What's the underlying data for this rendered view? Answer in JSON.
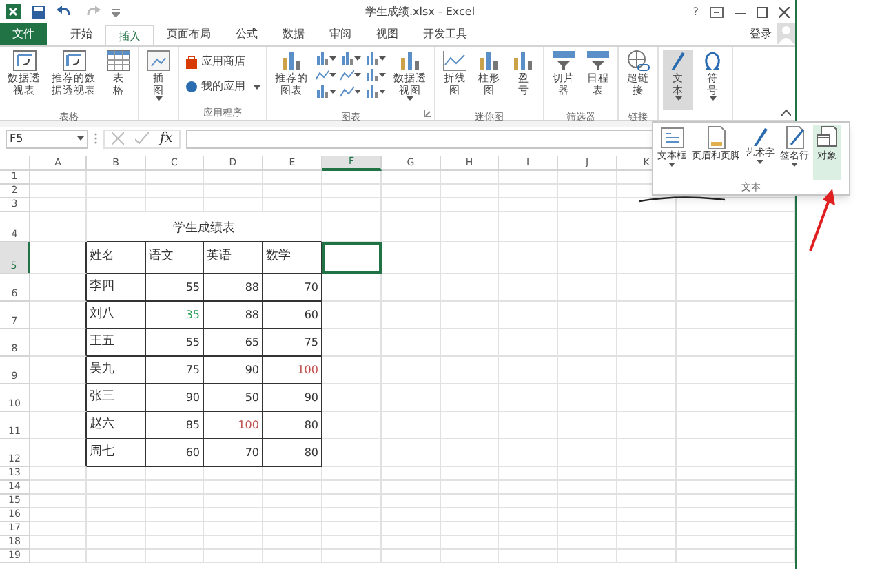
{
  "window": {
    "title": "学生成绩.xlsx - Excel",
    "help": "?"
  },
  "tabs": [
    {
      "label": "文件",
      "kind": "file",
      "selected": false
    },
    {
      "label": "开始",
      "kind": "tab",
      "selected": false
    },
    {
      "label": "插入",
      "kind": "tab",
      "selected": true
    },
    {
      "label": "页面布局",
      "kind": "tab",
      "selected": false
    },
    {
      "label": "公式",
      "kind": "tab",
      "selected": false
    },
    {
      "label": "数据",
      "kind": "tab",
      "selected": false
    },
    {
      "label": "审阅",
      "kind": "tab",
      "selected": false
    },
    {
      "label": "视图",
      "kind": "tab",
      "selected": false
    },
    {
      "label": "开发工具",
      "kind": "tab",
      "selected": false
    }
  ],
  "account": {
    "label": "登录"
  },
  "ribbon": {
    "groups": [
      {
        "label": "表格",
        "buttons": [
          {
            "kind": "large",
            "label": "数据透视表",
            "dropdown": false,
            "pressed": false
          },
          {
            "kind": "large",
            "label": "推荐的数据透视表",
            "dropdown": false,
            "pressed": false
          },
          {
            "kind": "large",
            "label": "表格",
            "dropdown": false,
            "pressed": false
          }
        ]
      },
      {
        "buttons": [
          {
            "kind": "large",
            "label": "插图",
            "dropdown": true,
            "pressed": false
          }
        ]
      },
      {
        "label": "应用程序",
        "buttons": [
          {
            "kind": "small",
            "label": "应用商店",
            "dropdown": false,
            "pressed": false
          },
          {
            "kind": "small",
            "label": "我的应用",
            "dropdown": true,
            "pressed": false
          }
        ]
      },
      {
        "label": "图表",
        "launcher": true,
        "buttons": [
          {
            "kind": "large",
            "label": "推荐的图表",
            "dropdown": false,
            "pressed": false
          },
          {
            "kind": "icons",
            "dropdown": true,
            "pressed": false
          },
          {
            "kind": "large",
            "label": "数据透视图",
            "dropdown": true,
            "pressed": false
          }
        ]
      },
      {
        "label": "迷你图",
        "buttons": [
          {
            "kind": "large",
            "label": "折线图",
            "dropdown": false,
            "pressed": false
          },
          {
            "kind": "large",
            "label": "柱形图",
            "dropdown": false,
            "pressed": false
          },
          {
            "kind": "large",
            "label": "盈亏",
            "dropdown": false,
            "pressed": false
          }
        ]
      },
      {
        "label": "筛选器",
        "buttons": [
          {
            "kind": "large",
            "label": "切片器",
            "dropdown": false,
            "pressed": false
          },
          {
            "kind": "large",
            "label": "日程表",
            "dropdown": false,
            "pressed": false
          }
        ]
      },
      {
        "label": "链接",
        "buttons": [
          {
            "kind": "large",
            "label": "超链接",
            "dropdown": false,
            "pressed": false
          }
        ]
      },
      {
        "buttons": [
          {
            "kind": "large",
            "label": "文本",
            "dropdown": true,
            "pressed": true
          },
          {
            "kind": "large",
            "label": "符号",
            "dropdown": true,
            "pressed": false
          }
        ]
      }
    ]
  },
  "text_menu": {
    "label": "文本",
    "items": [
      {
        "label": "文本框",
        "dropdown": true,
        "selected": false
      },
      {
        "label": "页眉和页脚",
        "dropdown": false,
        "selected": false
      },
      {
        "label": "艺术字",
        "dropdown": true,
        "selected": false
      },
      {
        "label": "签名行",
        "dropdown": true,
        "selected": false
      },
      {
        "label": "对象",
        "dropdown": false,
        "selected": true
      }
    ]
  },
  "formula_bar": {
    "name_box": "F5",
    "function_label": "fx"
  },
  "sheet": {
    "columns": [
      {
        "label": "A",
        "selected": false
      },
      {
        "label": "B",
        "selected": false
      },
      {
        "label": "C",
        "selected": false
      },
      {
        "label": "D",
        "selected": false
      },
      {
        "label": "E",
        "selected": false
      },
      {
        "label": "F",
        "selected": true
      },
      {
        "label": "G",
        "selected": false
      },
      {
        "label": "H",
        "selected": false
      },
      {
        "label": "I",
        "selected": false
      },
      {
        "label": "J",
        "selected": false
      },
      {
        "label": "K",
        "selected": false
      }
    ],
    "rows": [
      {
        "label": "1",
        "selected": false
      },
      {
        "label": "2",
        "selected": false
      },
      {
        "label": "3",
        "selected": false
      },
      {
        "label": "4",
        "selected": false
      },
      {
        "label": "5",
        "selected": true
      },
      {
        "label": "6",
        "selected": false
      },
      {
        "label": "7",
        "selected": false
      },
      {
        "label": "8",
        "selected": false
      },
      {
        "label": "9",
        "selected": false
      },
      {
        "label": "10",
        "selected": false
      },
      {
        "label": "11",
        "selected": false
      },
      {
        "label": "12",
        "selected": false
      },
      {
        "label": "13",
        "selected": false
      },
      {
        "label": "14",
        "selected": false
      },
      {
        "label": "15",
        "selected": false
      },
      {
        "label": "16",
        "selected": false
      },
      {
        "label": "17",
        "selected": false
      },
      {
        "label": "18",
        "selected": false
      },
      {
        "label": "19",
        "selected": false
      }
    ],
    "title": "学生成绩表",
    "table": {
      "header": [
        "姓名",
        "语文",
        "英语",
        "数学"
      ],
      "rows": [
        [
          {
            "text": "李四"
          },
          {
            "text": "55"
          },
          {
            "text": "88"
          },
          {
            "text": "70"
          }
        ],
        [
          {
            "text": "刘八"
          },
          {
            "text": "35",
            "color": "#2e9e5a"
          },
          {
            "text": "88"
          },
          {
            "text": "60"
          }
        ],
        [
          {
            "text": "王五"
          },
          {
            "text": "55"
          },
          {
            "text": "65"
          },
          {
            "text": "75"
          }
        ],
        [
          {
            "text": "吴九"
          },
          {
            "text": "75"
          },
          {
            "text": "90"
          },
          {
            "text": "100",
            "color": "#c0504d"
          }
        ],
        [
          {
            "text": "张三"
          },
          {
            "text": "90"
          },
          {
            "text": "50"
          },
          {
            "text": "90"
          }
        ],
        [
          {
            "text": "赵六"
          },
          {
            "text": "85"
          },
          {
            "text": "100",
            "color": "#c0504d"
          },
          {
            "text": "80"
          }
        ],
        [
          {
            "text": "周七"
          },
          {
            "text": "60"
          },
          {
            "text": "70"
          },
          {
            "text": "80"
          }
        ]
      ]
    }
  }
}
